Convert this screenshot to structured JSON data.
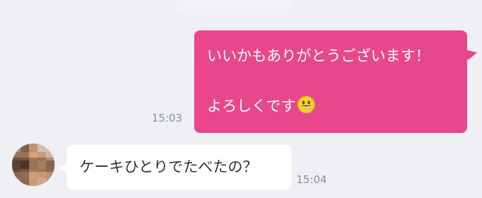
{
  "messages": {
    "outgoing": {
      "line1": "いいかもありがとうございます！",
      "line2": "よろしくです",
      "emoji": "smiling-face-emoji",
      "time": "15:03",
      "bubble_color": "#e8478c"
    },
    "incoming": {
      "text": "ケーキひとりでたべたの？",
      "time": "15:04",
      "bubble_color": "#ffffff"
    }
  },
  "avatar": {
    "icon": "blurred-user-avatar"
  },
  "colors": {
    "background": "#eef0f4",
    "timestamp": "#8b8f96"
  }
}
